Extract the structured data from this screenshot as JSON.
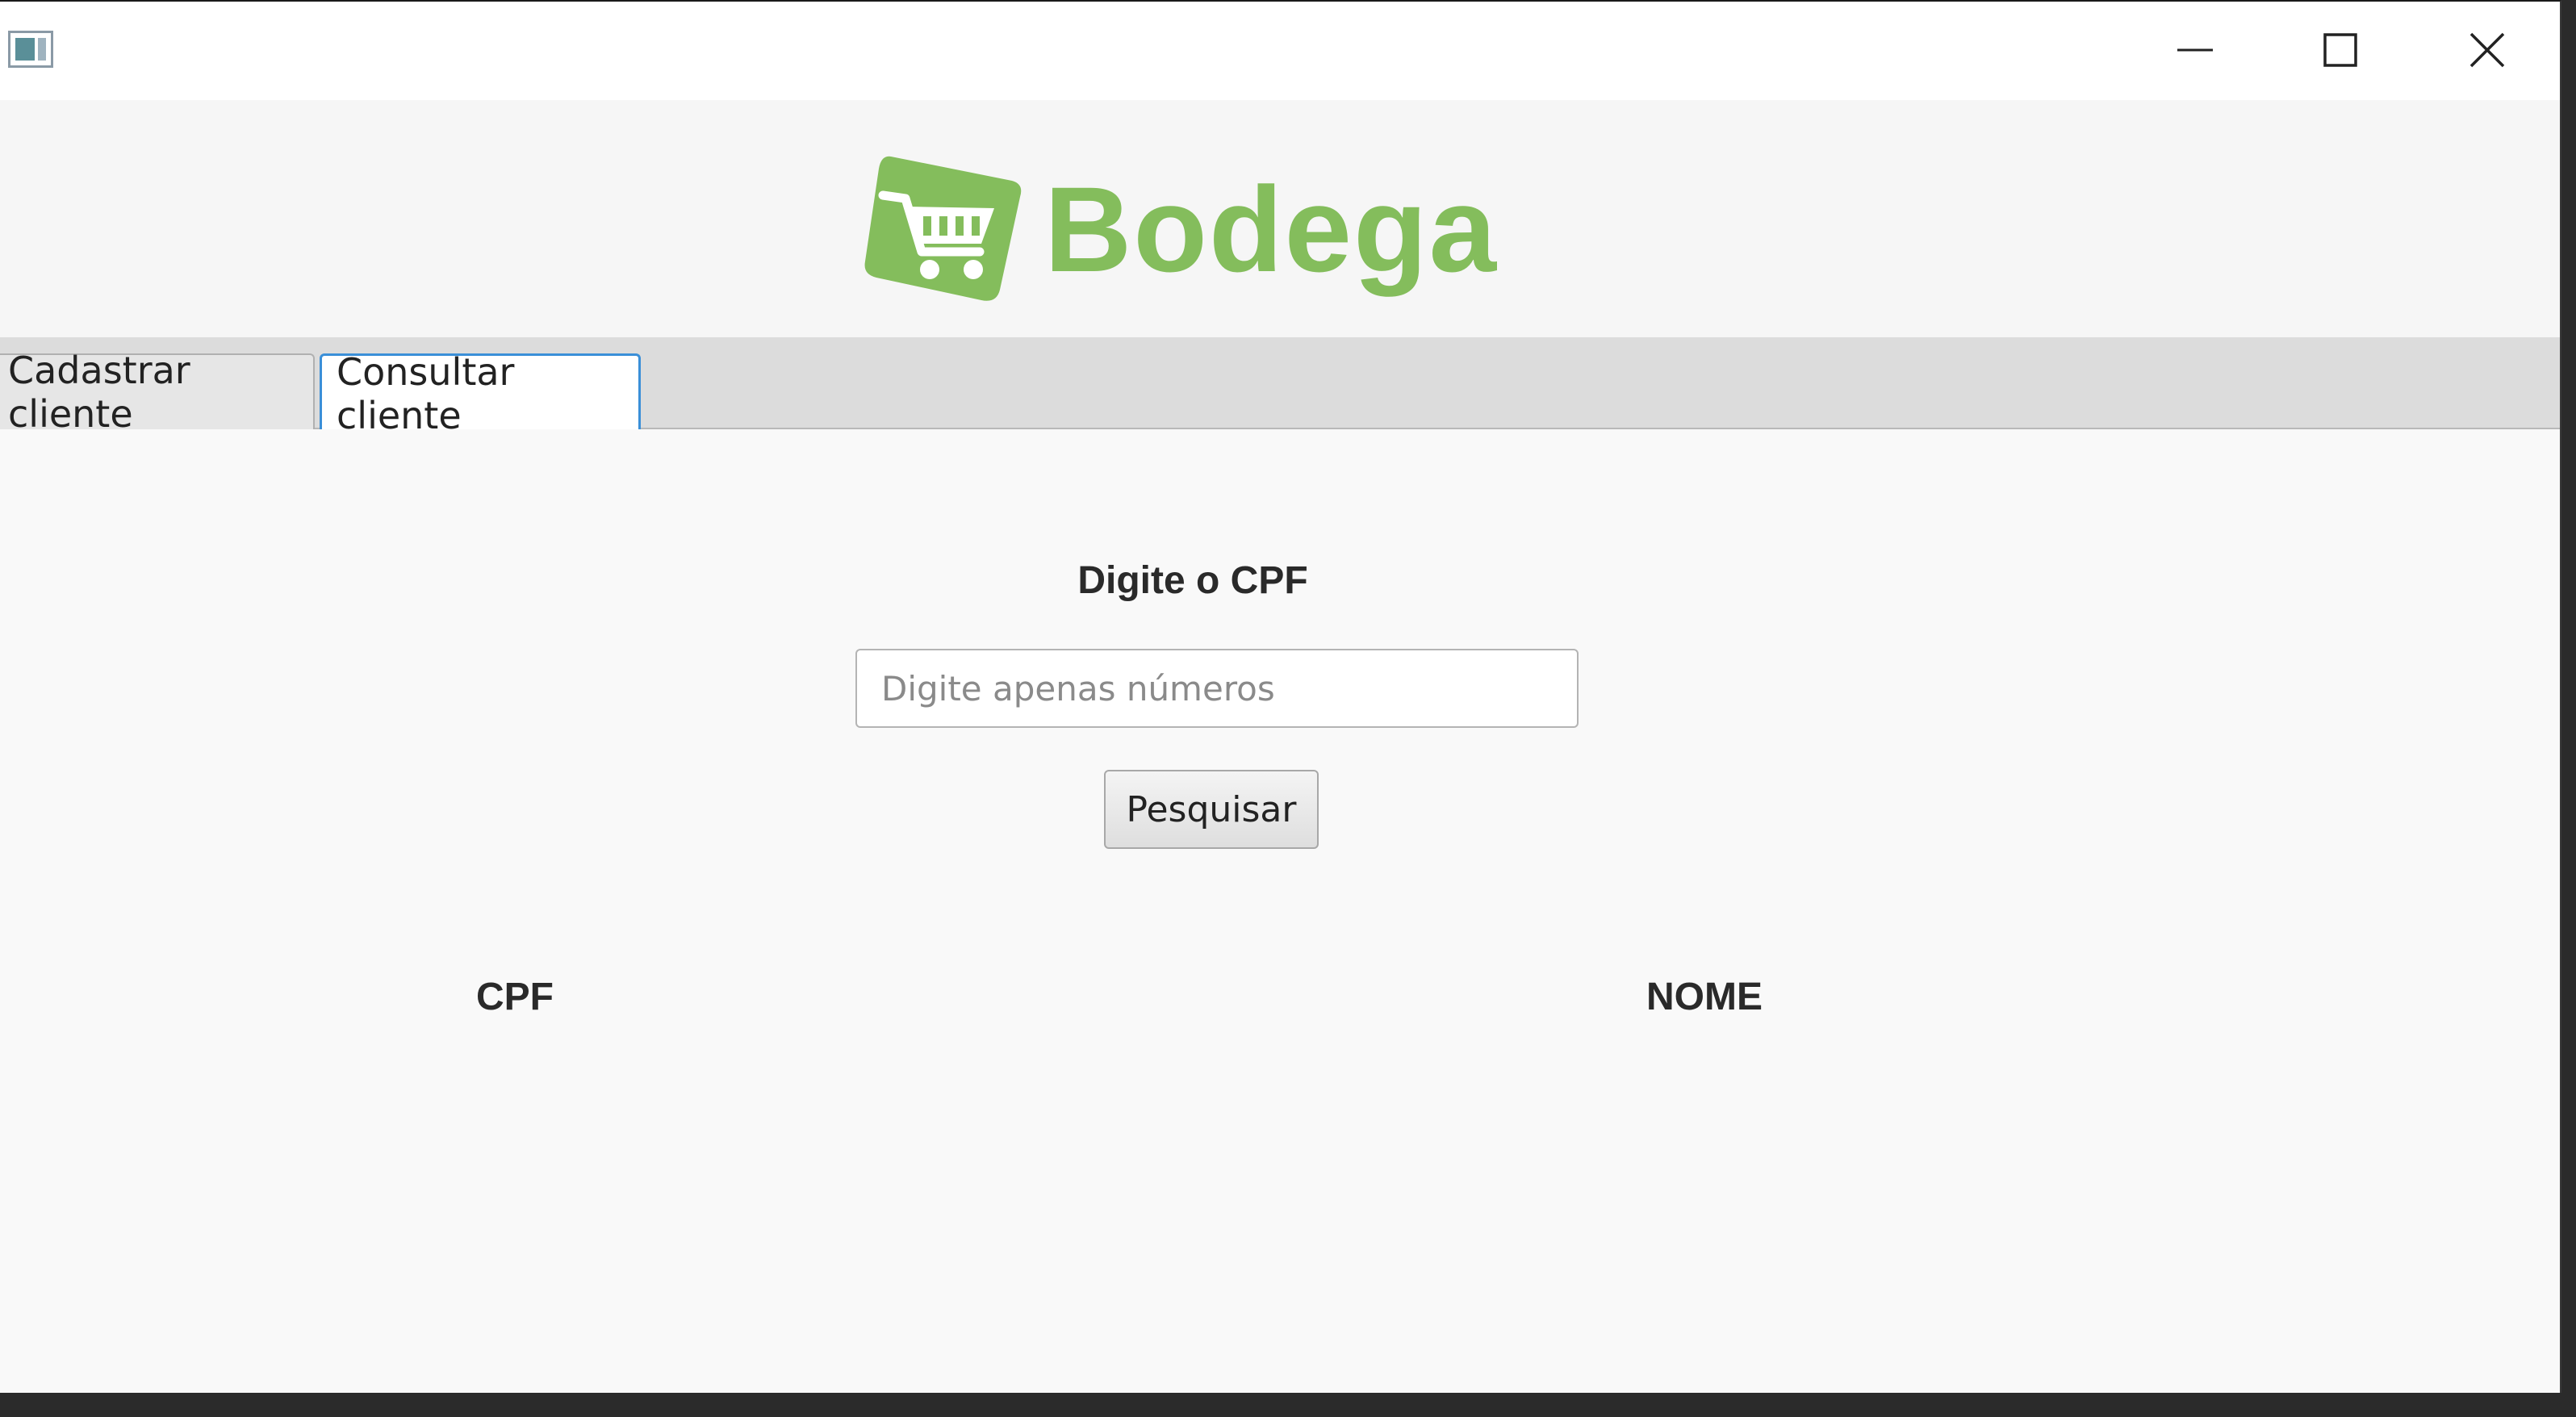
{
  "window": {
    "controls": {
      "minimize_icon": "minimize-icon",
      "maximize_icon": "maximize-icon",
      "close_icon": "close-icon"
    }
  },
  "header": {
    "logo_text": "Bodega",
    "logo_color": "#84bd5c"
  },
  "tabs": [
    {
      "label": "Cadastrar cliente",
      "selected": false
    },
    {
      "label": "Consultar cliente",
      "selected": true
    }
  ],
  "search": {
    "title": "Digite o CPF",
    "input_value": "",
    "input_placeholder": "Digite apenas números",
    "button_label": "Pesquisar"
  },
  "table": {
    "columns": [
      "CPF",
      "NOME"
    ],
    "rows": []
  },
  "colors": {
    "accent": "#3a8fd8",
    "brand": "#84bd5c"
  }
}
